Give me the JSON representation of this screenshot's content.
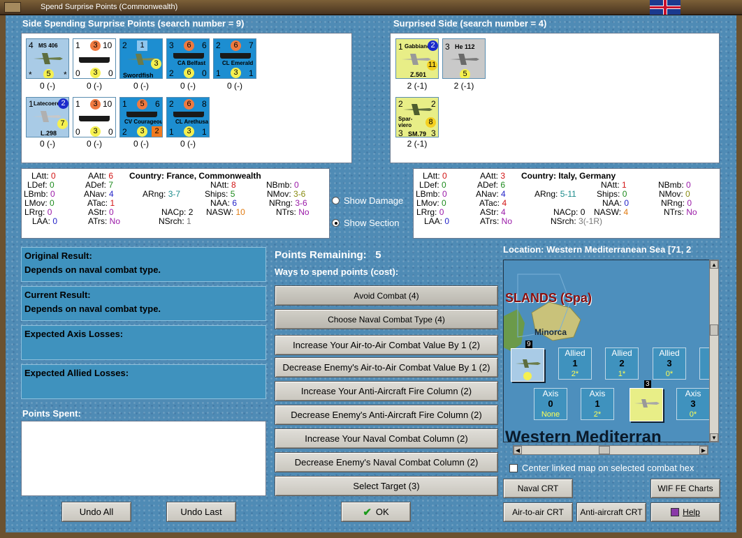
{
  "window": {
    "title": "Spend Surprise Points (Commonwealth)"
  },
  "spending": {
    "header": "Side Spending Surprise Points (search number = 9)",
    "units": [
      {
        "kind": "air",
        "tl": "4",
        "name": "MS 406",
        "bot": "*",
        "circle": "5",
        "br": "*",
        "label": "0 (-)"
      },
      {
        "kind": "nav",
        "tl": "1",
        "circle": "3",
        "tr": "10",
        "name": "",
        "bl": "0",
        "c2": "3",
        "br": "0",
        "label": "0 (-)"
      },
      {
        "kind": "air",
        "tl": "2",
        "name": "Swordfish",
        "circle": "1",
        "c2": "3",
        "label": "0 (-)"
      },
      {
        "kind": "nav",
        "tl": "3",
        "circle": "6",
        "tr": "6",
        "name": "CA Belfast",
        "bl": "2",
        "c2": "6",
        "br": "0",
        "label": "0 (-)"
      },
      {
        "kind": "nav",
        "tl": "2",
        "circle": "6",
        "tr": "7",
        "name": "CL Emerald",
        "bl": "1",
        "c2": "3",
        "br": "1",
        "label": "0 (-)"
      },
      {
        "kind": "air",
        "tl": "1",
        "name": "Latecoere",
        "circle": "2",
        "c2": "7",
        "sub": "L.298",
        "label": "0 (-)"
      },
      {
        "kind": "nav",
        "tl": "1",
        "circle": "3",
        "tr": "10",
        "name": "",
        "bl": "0",
        "c2": "3",
        "br": "0",
        "label": "0 (-)"
      },
      {
        "kind": "nav",
        "tl": "1",
        "circle": "5",
        "tr": "6",
        "name": "CV Courageous",
        "bl": "2",
        "c2": "3",
        "br": "2",
        "label": "0 (-)"
      },
      {
        "kind": "nav",
        "tl": "2",
        "circle": "6",
        "tr": "8",
        "name": "CL Arethusa",
        "bl": "1",
        "c2": "3",
        "br": "1",
        "label": "0 (-)"
      }
    ]
  },
  "surprised": {
    "header": "Surprised Side (search number = 4)",
    "units": [
      {
        "kind": "axis",
        "tl": "1",
        "name": "Gabbiano",
        "circle": "2",
        "c2": "11",
        "sub": "Z.501",
        "label": "2 (-1)"
      },
      {
        "kind": "gray",
        "tl": "3",
        "name": "He 112",
        "circle": "5",
        "label": "2 (-1)"
      },
      {
        "kind": "axis",
        "tl": "2",
        "tr": "2",
        "name": "Spar-viero",
        "c2": "8",
        "sub": "SM.79",
        "bl": "3",
        "br": "3",
        "label": "2 (-1)"
      }
    ]
  },
  "left_stats": {
    "country_label": "Country:",
    "country": "France, Commonwealth",
    "LAtt": "0",
    "LDef": "0",
    "LBmb": "0",
    "LMov": "0",
    "LRrg": "0",
    "LAA": "0",
    "AAtt": "6",
    "ADef": "7",
    "ANav": "4",
    "ATac": "1",
    "AStr": "0",
    "ATrs": "No",
    "ARng": "3-7",
    "NAtt": "8",
    "Ships": "5",
    "NAA": "6",
    "NACp": "2",
    "NSrch": "1",
    "NBmb": "0",
    "NMov": "3-6",
    "NRng": "3-6",
    "NASW": "10",
    "NTrs": "No"
  },
  "right_stats": {
    "country_label": "Country:",
    "country": "Italy, Germany",
    "LAtt": "0",
    "LDef": "0",
    "LBmb": "0",
    "LMov": "0",
    "LRrg": "0",
    "LAA": "0",
    "AAtt": "3",
    "ADef": "6",
    "ANav": "4",
    "ATac": "4",
    "AStr": "4",
    "ATrs": "No",
    "ARng": "5-11",
    "NAtt": "1",
    "Ships": "0",
    "NAA": "0",
    "NACp": "0",
    "NSrch": "3(-1R)",
    "NBmb": "0",
    "NMov": "0",
    "NRng": "0",
    "NASW": "4",
    "NTrs": "No"
  },
  "options": {
    "show_damage": "Show Damage",
    "show_section": "Show Section"
  },
  "results": {
    "original_label": "Original Result:",
    "original_value": "Depends on naval combat type.",
    "current_label": "Current Result:",
    "current_value": "Depends on naval combat type.",
    "axis_losses": "Expected Axis Losses:",
    "allied_losses": "Expected Allied Losses:",
    "points_spent": "Points Spent:"
  },
  "points": {
    "label": "Points Remaining:",
    "value": "5",
    "ways": "Ways to spend points (cost):"
  },
  "actions": [
    "Avoid Combat (4)",
    "Choose Naval Combat Type (4)",
    "Increase Your Air-to-Air Combat Value By 1 (2)",
    "Decrease Enemy's Air-to-Air Combat Value By 1 (2)",
    "Increase Your Anti-Aircraft Fire Column (2)",
    "Decrease Enemy's Anti-Aircraft Fire Column (2)",
    "Increase Your Naval Combat Column (2)",
    "Decrease Enemy's Naval Combat Column (2)",
    "Select Target (3)"
  ],
  "location": {
    "label": "Location: Western Mediterranean Sea [71, 2",
    "islands": "SLANDS (Spa)",
    "minorca": "Minorca",
    "sea": "Western Mediterran",
    "allied": [
      {
        "t": "Allied",
        "n": "1",
        "s": "2*"
      },
      {
        "t": "Allied",
        "n": "2",
        "s": "1*"
      },
      {
        "t": "Allied",
        "n": "3",
        "s": "0*"
      }
    ],
    "axis": [
      {
        "t": "Axis",
        "n": "0",
        "s": "None"
      },
      {
        "t": "Axis",
        "n": "1",
        "s": "2*"
      },
      {
        "t": "Axis",
        "n": "3",
        "s": "0*"
      }
    ],
    "stack_allied": "9",
    "stack_axis": "3"
  },
  "map_controls": {
    "center_label": "Center linked map on selected combat hex",
    "naval_crt": "Naval CRT",
    "wif_charts": "WIF FE Charts",
    "air_crt": "Air-to-air CRT",
    "aa_crt": "Anti-aircraft CRT",
    "help": "Help"
  },
  "bottom": {
    "undo_all": "Undo All",
    "undo_last": "Undo Last",
    "ok": "OK"
  }
}
